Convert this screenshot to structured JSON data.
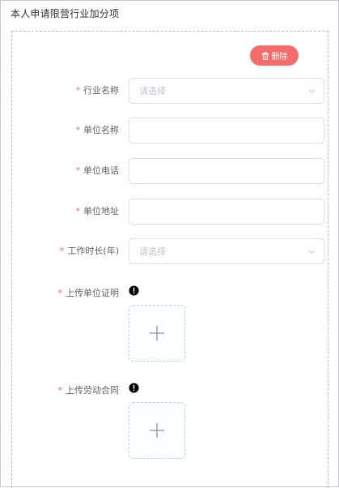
{
  "section": {
    "title": "本人申请限营行业加分项"
  },
  "delete_button": {
    "label": "删除",
    "icon": "trash-icon"
  },
  "form": {
    "industry": {
      "label": "行业名称",
      "placeholder": "请选择"
    },
    "unit_name": {
      "label": "单位名称",
      "value": ""
    },
    "unit_phone": {
      "label": "单位电话",
      "value": ""
    },
    "unit_address": {
      "label": "单位地址",
      "value": ""
    },
    "work_years": {
      "label": "工作时长(年)",
      "placeholder": "请选择"
    },
    "unit_proof": {
      "label": "上传单位证明"
    },
    "labor_contract": {
      "label": "上传劳动合同"
    }
  },
  "colors": {
    "danger": "#f56c6c",
    "required": "#f56c6c",
    "border": "#dcdfe6",
    "placeholder": "#c0c4cc"
  }
}
